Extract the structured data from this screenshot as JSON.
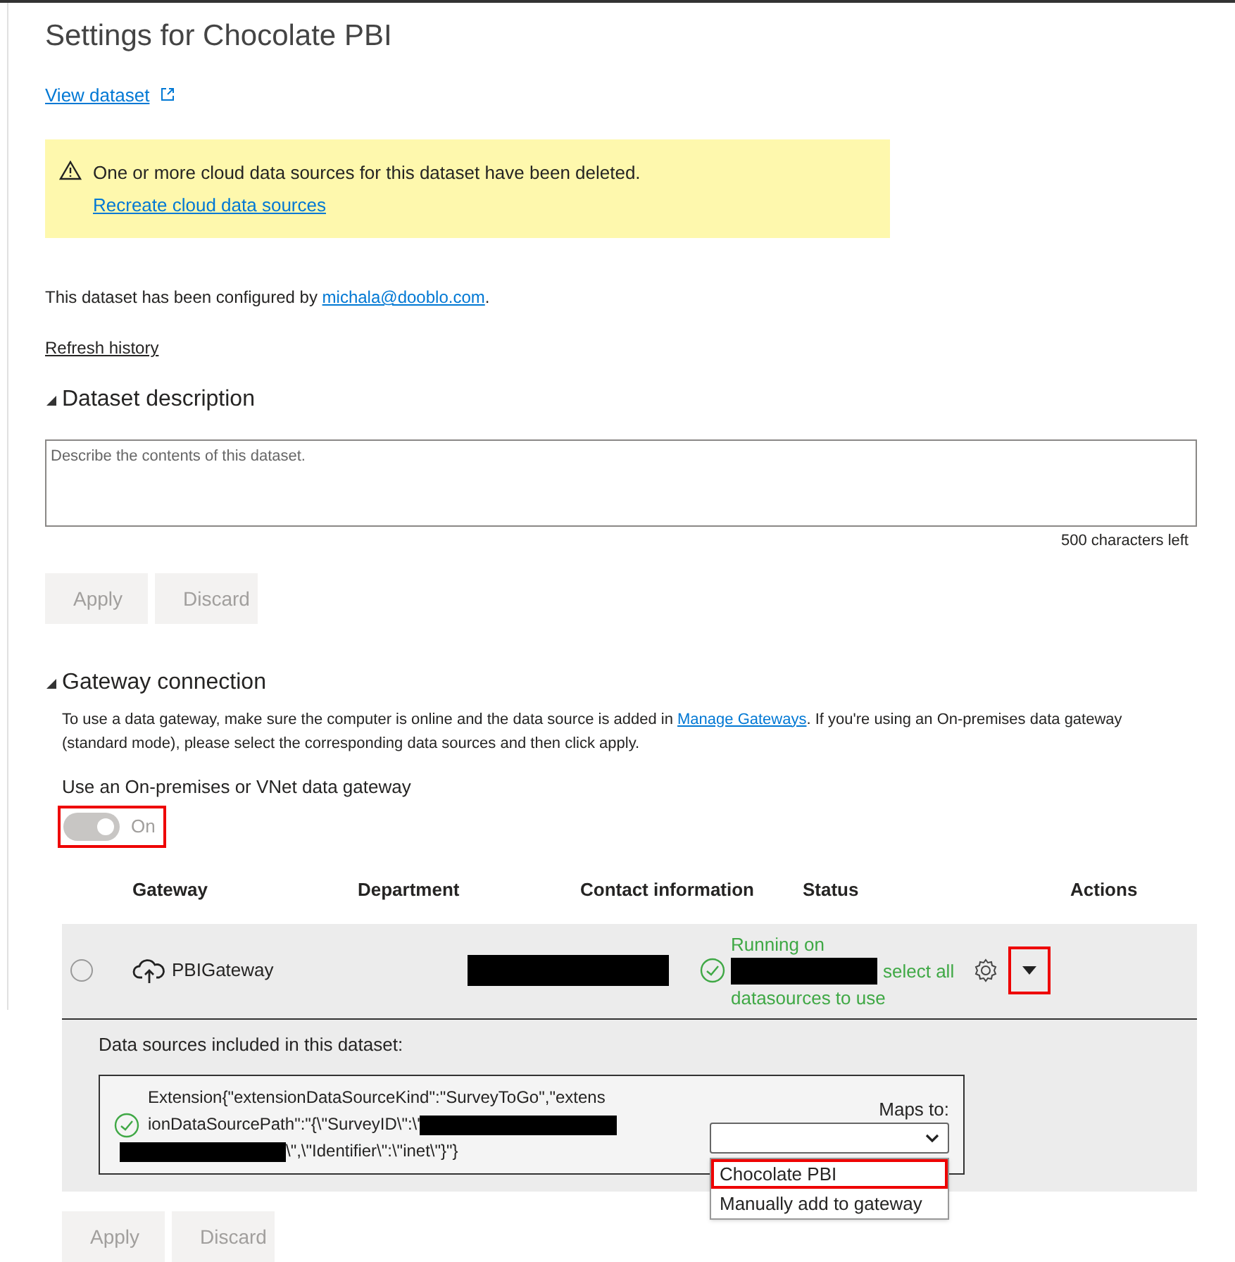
{
  "title": "Settings for Chocolate PBI",
  "view_link": "View dataset",
  "warning": {
    "message": "One or more cloud data sources for this dataset have been deleted.",
    "link": "Recreate cloud data sources"
  },
  "configured": {
    "text": "This dataset has been configured by ",
    "email": "michala@dooblo.com",
    "suffix": "."
  },
  "refresh_link": "Refresh history",
  "description_section": {
    "title": "Dataset description",
    "expanded": true,
    "placeholder": "Describe the contents of this dataset.",
    "counter": "500 characters left",
    "buttons": [
      {
        "label": "Apply",
        "disabled": true
      },
      {
        "label": "Discard",
        "disabled": true
      }
    ]
  },
  "gateway_section": {
    "title": "Gateway connection",
    "expanded": true,
    "info_before": "To use a data gateway, make sure the computer is online and the data source is added in ",
    "info_link": "Manage Gateways",
    "info_after": ". If you're using an On-premises data gateway (standard mode), please select the corresponding data sources and then click apply.",
    "toggle": {
      "label": "Use an On-premises or VNet data gateway",
      "on": true,
      "disabled": true,
      "state_text": "On",
      "highlighted": true
    },
    "columns": [
      "Gateway",
      "Department",
      "Contact information",
      "Status",
      "Actions"
    ],
    "rows": [
      {
        "selected": false,
        "name": "PBIGateway",
        "status_before": "Running on",
        "status_after": "select all datasources to use",
        "expanded": true,
        "expand_highlighted": true,
        "sources_title": "Data sources included in this dataset:",
        "source": {
          "line_1": "Extension{\"extensionDataSourceKind\":\"SurveyToGo\",\"extens",
          "line_2": "ionDataSourcePath\":\"{\\\"SurveyID\\\":\\'",
          "line_3": "\\\",\\\"Identifier\\\":\\\"inet\\\"}\"}",
          "maps_label": "Maps to:",
          "options": [
            {
              "label": "Chocolate PBI",
              "highlighted": true
            },
            {
              "label": "Manually add to gateway",
              "highlighted": false
            }
          ]
        }
      }
    ],
    "buttons": [
      {
        "label": "Apply",
        "disabled": true
      },
      {
        "label": "Discard",
        "disabled": true
      }
    ]
  }
}
